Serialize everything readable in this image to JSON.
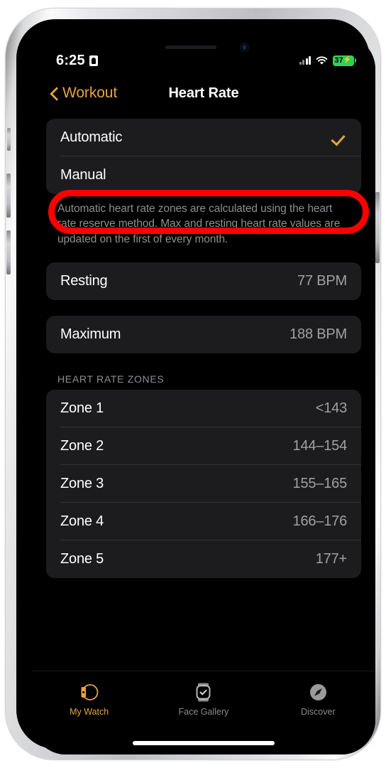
{
  "status_bar": {
    "time": "6:25",
    "lock_icon": "id-badge-icon",
    "cellular_icon": "cellular-signal-icon",
    "wifi_icon": "wifi-icon",
    "battery_level": "37",
    "battery_bolt": "⚡",
    "battery_icon": "battery-charging-icon",
    "battery_color": "#30d158"
  },
  "nav": {
    "back_label": "Workout",
    "back_icon": "chevron-left-icon",
    "title": "Heart Rate",
    "accent_color": "#e7a33e"
  },
  "mode_section": {
    "options": [
      {
        "label": "Automatic",
        "selected": true,
        "check_icon": "checkmark-icon"
      },
      {
        "label": "Manual",
        "selected": false,
        "check_icon": ""
      }
    ],
    "footer": "Automatic heart rate zones are calculated using the heart rate reserve method. Max and resting heart rate values are updated on the first of every month."
  },
  "resting": {
    "label": "Resting",
    "value": "77 BPM"
  },
  "maximum": {
    "label": "Maximum",
    "value": "188 BPM"
  },
  "zones_section": {
    "header": "HEART RATE ZONES",
    "rows": [
      {
        "label": "Zone 1",
        "value": "<143"
      },
      {
        "label": "Zone 2",
        "value": "144–154"
      },
      {
        "label": "Zone 3",
        "value": "155–165"
      },
      {
        "label": "Zone 4",
        "value": "166–176"
      },
      {
        "label": "Zone 5",
        "value": "177+"
      }
    ]
  },
  "annotation": {
    "target": "Manual",
    "shape": "rounded-rectangle-outline",
    "color": "#fe0000"
  },
  "tab_bar": {
    "tabs": [
      {
        "label": "My Watch",
        "icon": "watch-side-icon",
        "active": true
      },
      {
        "label": "Face Gallery",
        "icon": "watch-face-icon",
        "active": false
      },
      {
        "label": "Discover",
        "icon": "compass-icon",
        "active": false
      }
    ]
  }
}
